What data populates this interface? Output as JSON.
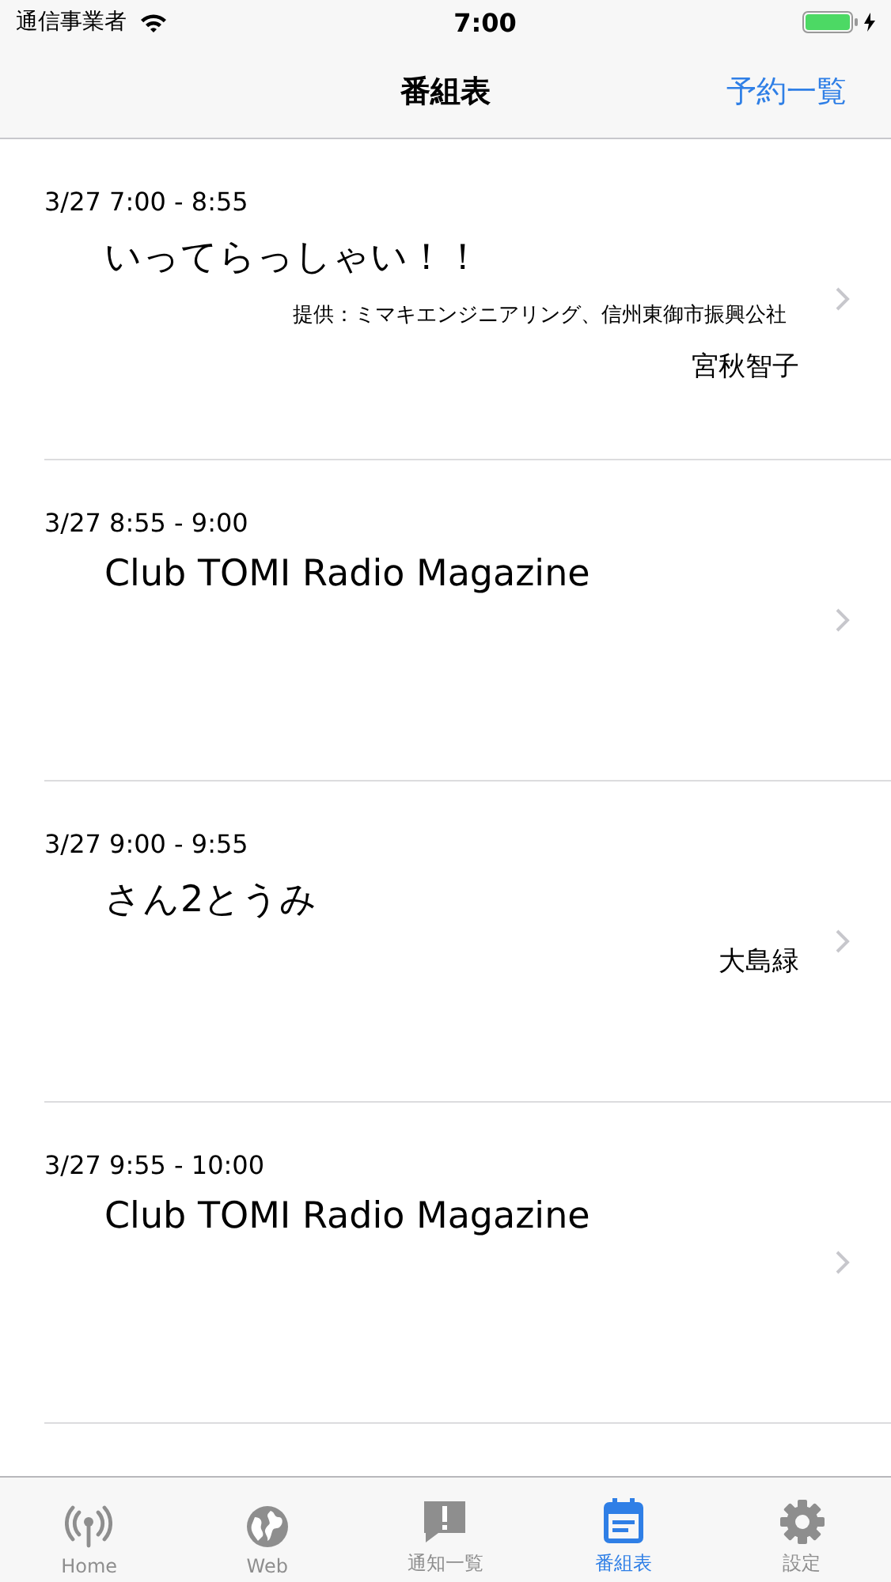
{
  "status_bar": {
    "carrier": "通信事業者",
    "time": "7:00"
  },
  "nav": {
    "title": "番組表",
    "action": "予約一覧"
  },
  "programs": [
    {
      "time": "3/27 7:00 - 8:55",
      "title": "いってらっしゃい！！",
      "sponsor": "提供：ミマキエンジニアリング、信州東御市振興公社",
      "host": "宮秋智子"
    },
    {
      "time": "3/27 8:55 - 9:00",
      "title": "Club TOMI Radio Magazine"
    },
    {
      "time": "3/27 9:00 - 9:55",
      "title": "さん2とうみ",
      "host": "大島緑"
    },
    {
      "time": "3/27 9:55 - 10:00",
      "title": "Club TOMI Radio Magazine"
    }
  ],
  "tabs": [
    {
      "label": "Home",
      "kind": "antenna",
      "selected": false
    },
    {
      "label": "Web",
      "kind": "globe",
      "selected": false
    },
    {
      "label": "通知一覧",
      "kind": "alert",
      "selected": false
    },
    {
      "label": "番組表",
      "kind": "calendar",
      "selected": true
    },
    {
      "label": "設定",
      "kind": "gear",
      "selected": false
    }
  ]
}
